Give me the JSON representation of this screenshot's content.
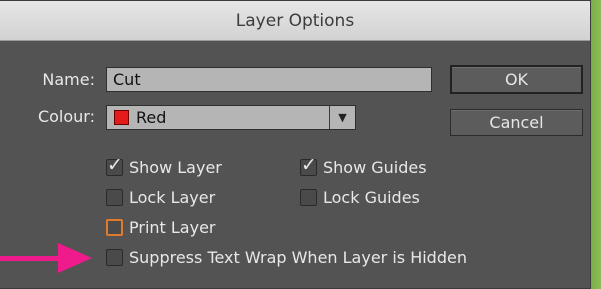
{
  "window": {
    "title": "Layer Options"
  },
  "form": {
    "name_label": "Name:",
    "name_value": "Cut",
    "colour_label": "Colour:",
    "colour_value": "Red",
    "colour_swatch": "#e31b1b"
  },
  "buttons": {
    "ok": "OK",
    "cancel": "Cancel"
  },
  "checkboxes": [
    {
      "label": "Show Layer",
      "checked": true
    },
    {
      "label": "Show Guides",
      "checked": true
    },
    {
      "label": "Lock Layer",
      "checked": false
    },
    {
      "label": "Lock Guides",
      "checked": false
    },
    {
      "label": "Print Layer",
      "checked": false,
      "focused": true
    },
    {
      "label": "Suppress Text Wrap When Layer is Hidden",
      "checked": false
    }
  ],
  "annotation": {
    "arrow_color": "#ef1a8c",
    "points_to": "Suppress Text Wrap When Layer is Hidden"
  }
}
